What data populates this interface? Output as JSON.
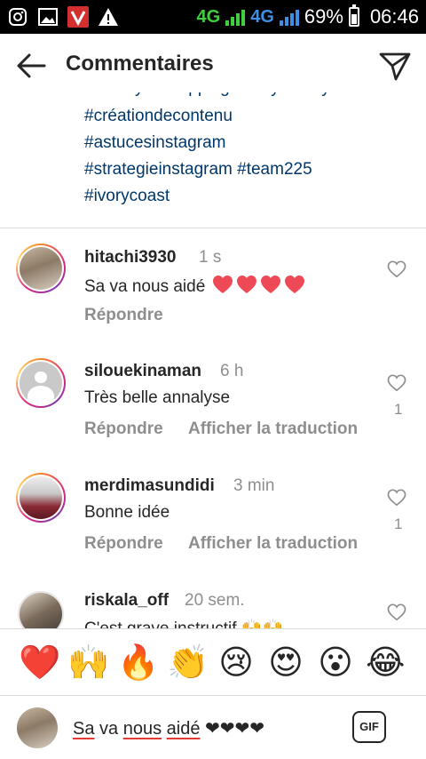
{
  "status_bar": {
    "network_1": "4G",
    "network_2": "4G",
    "battery": "69%",
    "time": "06:46",
    "icons": [
      "instagram-icon",
      "gallery-icon",
      "vivo-app-icon",
      "warning-icon"
    ]
  },
  "header": {
    "title": "Commentaires",
    "back_icon": "arrow-left-icon",
    "send_icon": "paper-plane-icon"
  },
  "caption": {
    "cut_line": "#tokenyavocopping #ivoryfactory",
    "lines": [
      "#créationdecontenu",
      "#astucesinstagram",
      "#strategieinstagram #team225",
      "#ivorycoast"
    ]
  },
  "comments": [
    {
      "username": "hitachi3930",
      "time": "1 s",
      "text": "Sa va nous aidé",
      "hearts": 4,
      "reply": "Répondre",
      "translate": "",
      "likes": ""
    },
    {
      "username": "silouekinaman",
      "time": "6 h",
      "text": "Très belle annalyse",
      "hearts": 0,
      "reply": "Répondre",
      "translate": "Afficher la traduction",
      "likes": "1"
    },
    {
      "username": "merdimasundidi",
      "time": "3 min",
      "text": "Bonne idée",
      "hearts": 0,
      "reply": "Répondre",
      "translate": "Afficher la traduction",
      "likes": "1"
    },
    {
      "username": "riskala_off",
      "time": "20 sem.",
      "text": "C'est grave instructif 🙌🙌",
      "hearts": 0,
      "reply": "",
      "translate": "",
      "likes": ""
    }
  ],
  "emoji_bar": [
    "❤️",
    "🙌",
    "🔥",
    "👏",
    "😢",
    "😍",
    "😮",
    "😂"
  ],
  "input": {
    "words": [
      "Sa",
      "va",
      "nous",
      "aidé"
    ],
    "hearts": "❤❤❤❤",
    "gif_label": "GIF"
  },
  "colors": {
    "hashtag": "#00376b",
    "muted": "#8e8e8e",
    "text": "#262626",
    "heart_red": "#ed4956"
  }
}
